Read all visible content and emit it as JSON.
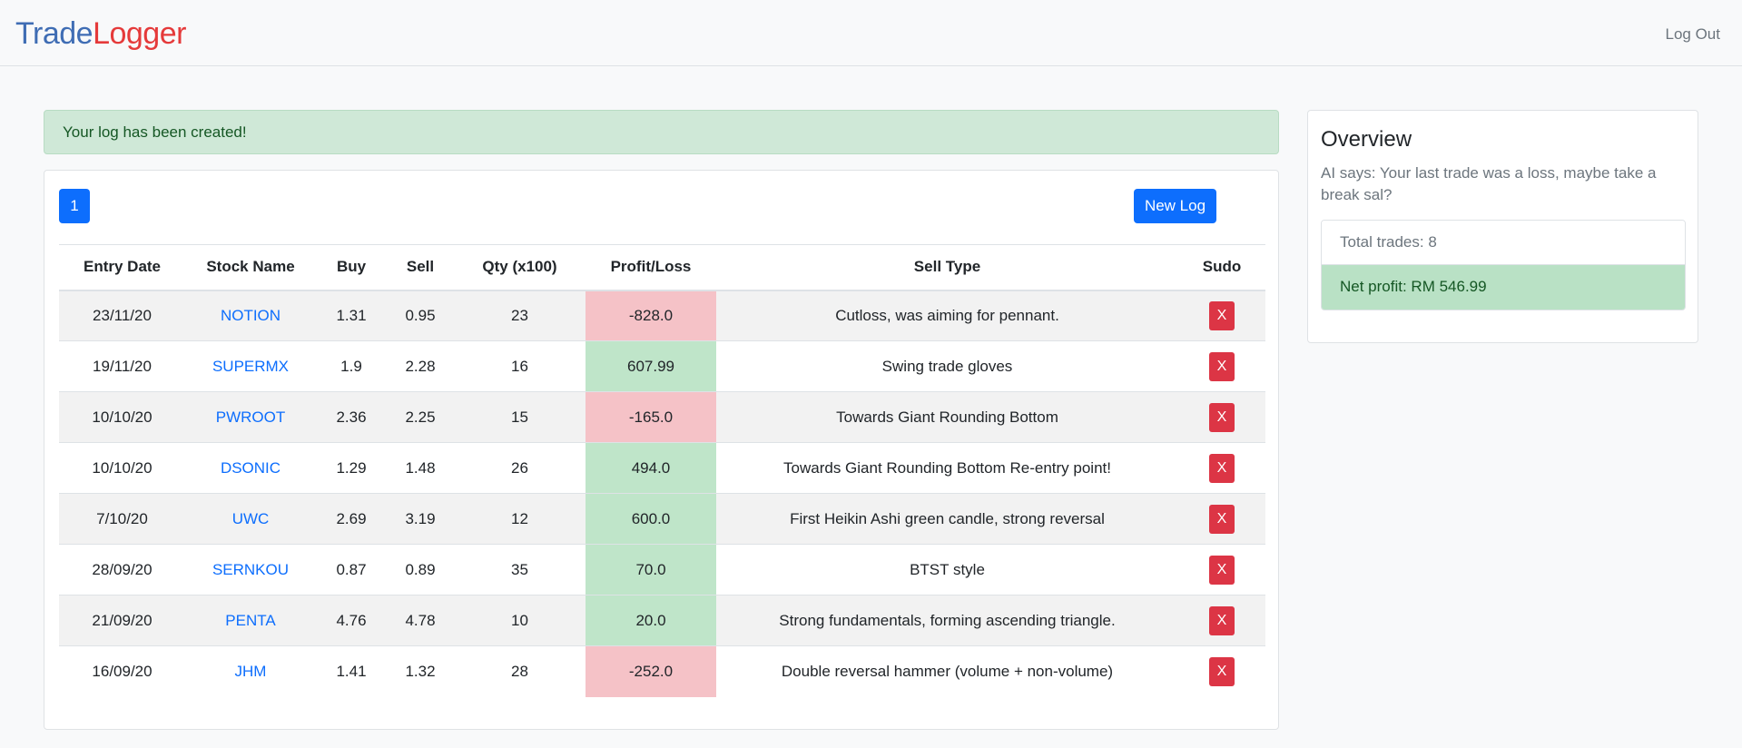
{
  "navbar": {
    "brand_part1": "Trade",
    "brand_part2": "Logger",
    "logout_label": "Log Out"
  },
  "alert": {
    "message": "Your log has been created!"
  },
  "toolbar": {
    "page_label": "1",
    "new_log_label": "New Log"
  },
  "table": {
    "headers": [
      "Entry Date",
      "Stock Name",
      "Buy",
      "Sell",
      "Qty (x100)",
      "Profit/Loss",
      "Sell Type",
      "Sudo"
    ],
    "rows": [
      {
        "date": "23/11/20",
        "stock": "NOTION",
        "buy": "1.31",
        "sell": "0.95",
        "qty": "23",
        "pl": "-828.0",
        "type": "Cutloss, was aiming for pennant.",
        "delete": "X"
      },
      {
        "date": "19/11/20",
        "stock": "SUPERMX",
        "buy": "1.9",
        "sell": "2.28",
        "qty": "16",
        "pl": "607.99",
        "type": "Swing trade gloves",
        "delete": "X"
      },
      {
        "date": "10/10/20",
        "stock": "PWROOT",
        "buy": "2.36",
        "sell": "2.25",
        "qty": "15",
        "pl": "-165.0",
        "type": "Towards Giant Rounding Bottom",
        "delete": "X"
      },
      {
        "date": "10/10/20",
        "stock": "DSONIC",
        "buy": "1.29",
        "sell": "1.48",
        "qty": "26",
        "pl": "494.0",
        "type": "Towards Giant Rounding Bottom Re-entry point!",
        "delete": "X"
      },
      {
        "date": "7/10/20",
        "stock": "UWC",
        "buy": "2.69",
        "sell": "3.19",
        "qty": "12",
        "pl": "600.0",
        "type": "First Heikin Ashi green candle, strong reversal",
        "delete": "X"
      },
      {
        "date": "28/09/20",
        "stock": "SERNKOU",
        "buy": "0.87",
        "sell": "0.89",
        "qty": "35",
        "pl": "70.0",
        "type": "BTST style",
        "delete": "X"
      },
      {
        "date": "21/09/20",
        "stock": "PENTA",
        "buy": "4.76",
        "sell": "4.78",
        "qty": "10",
        "pl": "20.0",
        "type": "Strong fundamentals, forming ascending triangle.",
        "delete": "X"
      },
      {
        "date": "16/09/20",
        "stock": "JHM",
        "buy": "1.41",
        "sell": "1.32",
        "qty": "28",
        "pl": "-252.0",
        "type": "Double reversal hammer (volume + non-volume)",
        "delete": "X"
      }
    ]
  },
  "overview": {
    "title": "Overview",
    "ai_message": "AI says: Your last trade was a loss, maybe take a break sal?",
    "total_trades": "Total trades: 8",
    "net_profit": "Net profit: RM 546.99"
  },
  "colors": {
    "primary": "#0d6efd",
    "danger": "#dc3545",
    "profit_bg": "#bfe5c9",
    "loss_bg": "#f5c2c7",
    "alert_bg": "#cfe8d7"
  }
}
